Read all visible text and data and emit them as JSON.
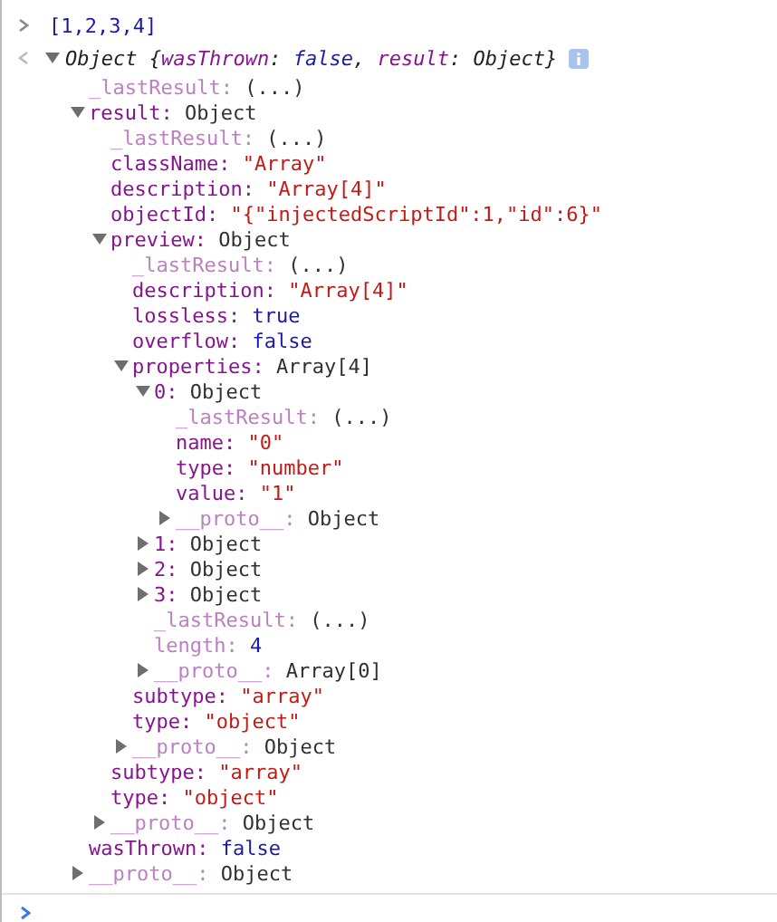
{
  "entries": [
    {
      "kind": "input",
      "text": "[1,2,3,4]"
    },
    {
      "kind": "output",
      "expanded": true,
      "summary": [
        {
          "text": "Object {",
          "kind": "plain"
        },
        {
          "text": "wasThrown",
          "kind": "key"
        },
        {
          "text": ": ",
          "kind": "plain"
        },
        {
          "text": "false",
          "kind": "keyword"
        },
        {
          "text": ", ",
          "kind": "plain"
        },
        {
          "text": "result",
          "kind": "key"
        },
        {
          "text": ": Object}",
          "kind": "plain"
        }
      ],
      "children": [
        {
          "key": "_lastResult:",
          "value": "(...)",
          "kind": "getter",
          "enumerable": false
        },
        {
          "key": "result:",
          "value": "Object",
          "kind": "object",
          "enumerable": true,
          "expanded": true,
          "children": [
            {
              "key": "_lastResult:",
              "value": "(...)",
              "kind": "getter",
              "enumerable": false
            },
            {
              "key": "className:",
              "value": "\"Array\"",
              "kind": "string",
              "enumerable": true
            },
            {
              "key": "description:",
              "value": "\"Array[4]\"",
              "kind": "string",
              "enumerable": true
            },
            {
              "key": "objectId:",
              "value": "\"{\"injectedScriptId\":1,\"id\":6}\"",
              "kind": "string",
              "enumerable": true
            },
            {
              "key": "preview:",
              "value": "Object",
              "kind": "object",
              "enumerable": true,
              "expanded": true,
              "children": [
                {
                  "key": "_lastResult:",
                  "value": "(...)",
                  "kind": "getter",
                  "enumerable": false
                },
                {
                  "key": "description:",
                  "value": "\"Array[4]\"",
                  "kind": "string",
                  "enumerable": true
                },
                {
                  "key": "lossless:",
                  "value": "true",
                  "kind": "keyword",
                  "enumerable": true
                },
                {
                  "key": "overflow:",
                  "value": "false",
                  "kind": "keyword",
                  "enumerable": true
                },
                {
                  "key": "properties:",
                  "value": "Array[4]",
                  "kind": "object",
                  "enumerable": true,
                  "expanded": true,
                  "children": [
                    {
                      "key": "0:",
                      "value": "Object",
                      "kind": "object",
                      "enumerable": true,
                      "expanded": true,
                      "children": [
                        {
                          "key": "_lastResult:",
                          "value": "(...)",
                          "kind": "getter",
                          "enumerable": false
                        },
                        {
                          "key": "name:",
                          "value": "\"0\"",
                          "kind": "string",
                          "enumerable": true
                        },
                        {
                          "key": "type:",
                          "value": "\"number\"",
                          "kind": "string",
                          "enumerable": true
                        },
                        {
                          "key": "value:",
                          "value": "\"1\"",
                          "kind": "string",
                          "enumerable": true
                        },
                        {
                          "key": "__proto__:",
                          "value": "Object",
                          "kind": "object",
                          "enumerable": false,
                          "expanded": false
                        }
                      ]
                    },
                    {
                      "key": "1:",
                      "value": "Object",
                      "kind": "object",
                      "enumerable": true,
                      "expanded": false
                    },
                    {
                      "key": "2:",
                      "value": "Object",
                      "kind": "object",
                      "enumerable": true,
                      "expanded": false
                    },
                    {
                      "key": "3:",
                      "value": "Object",
                      "kind": "object",
                      "enumerable": true,
                      "expanded": false
                    },
                    {
                      "key": "_lastResult:",
                      "value": "(...)",
                      "kind": "getter",
                      "enumerable": false
                    },
                    {
                      "key": "length:",
                      "value": "4",
                      "kind": "keyword",
                      "enumerable": false
                    },
                    {
                      "key": "__proto__:",
                      "value": "Array[0]",
                      "kind": "object",
                      "enumerable": false,
                      "expanded": false
                    }
                  ]
                },
                {
                  "key": "subtype:",
                  "value": "\"array\"",
                  "kind": "string",
                  "enumerable": true
                },
                {
                  "key": "type:",
                  "value": "\"object\"",
                  "kind": "string",
                  "enumerable": true
                },
                {
                  "key": "__proto__:",
                  "value": "Object",
                  "kind": "object",
                  "enumerable": false,
                  "expanded": false
                }
              ]
            },
            {
              "key": "subtype:",
              "value": "\"array\"",
              "kind": "string",
              "enumerable": true
            },
            {
              "key": "type:",
              "value": "\"object\"",
              "kind": "string",
              "enumerable": true
            },
            {
              "key": "__proto__:",
              "value": "Object",
              "kind": "object",
              "enumerable": false,
              "expanded": false
            }
          ]
        },
        {
          "key": "wasThrown:",
          "value": "false",
          "kind": "keyword",
          "enumerable": true
        },
        {
          "key": "__proto__:",
          "value": "Object",
          "kind": "object",
          "enumerable": false,
          "expanded": false
        }
      ]
    }
  ]
}
